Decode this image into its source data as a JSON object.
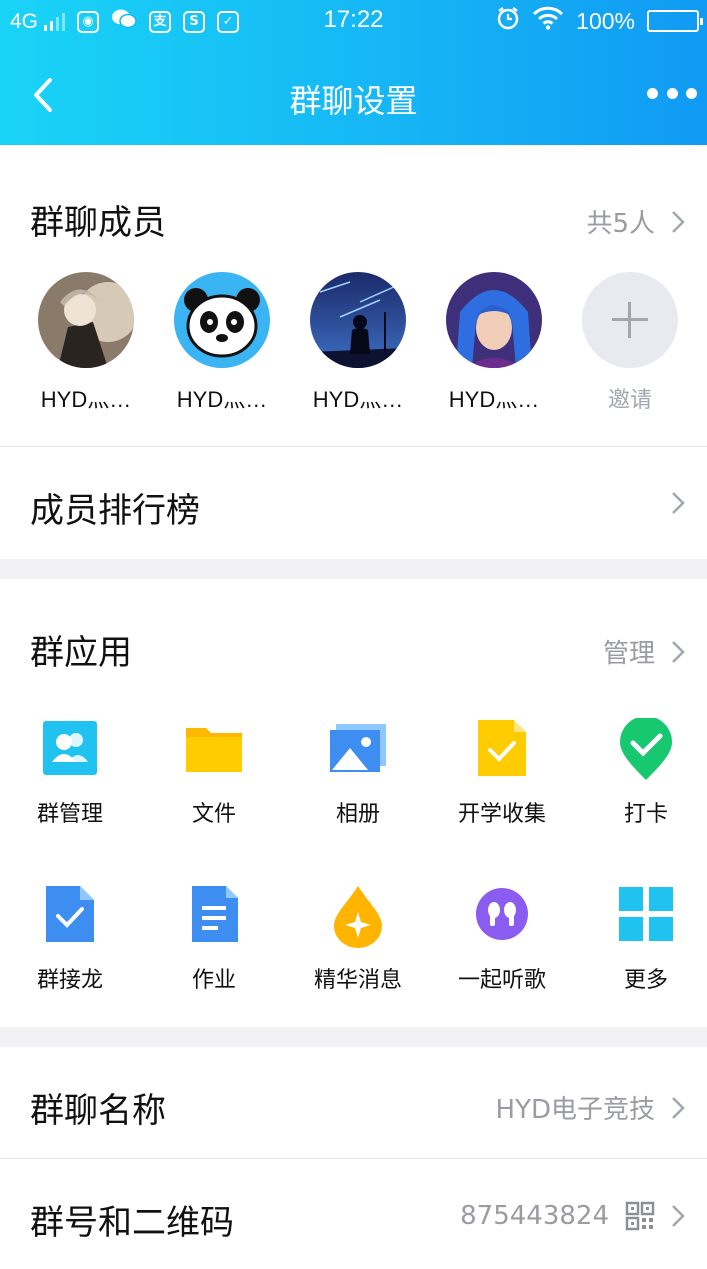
{
  "status_bar": {
    "network": "4G",
    "time": "17:22",
    "battery": "100%",
    "app_icons": [
      "globe-icon",
      "wechat-icon",
      "alipay-icon",
      "s-app-icon",
      "check-app-icon"
    ],
    "right_icons": [
      "alarm-icon",
      "wifi-icon",
      "battery-icon"
    ]
  },
  "nav": {
    "title": "群聊设置",
    "back_icon": "back-arrow-icon",
    "more_icon": "more-dots-icon"
  },
  "members_section": {
    "title": "群聊成员",
    "count": "共5人",
    "members": [
      {
        "name": "HYD灬…",
        "avatar": "anime-boy-avatar"
      },
      {
        "name": "HYD灬…",
        "avatar": "panda-avatar"
      },
      {
        "name": "HYD灬…",
        "avatar": "night-silhouette-avatar"
      },
      {
        "name": "HYD灬…",
        "avatar": "blue-hair-avatar"
      }
    ],
    "invite_label": "邀请"
  },
  "ranking": {
    "title": "成员排行榜"
  },
  "apps_section": {
    "title": "群应用",
    "manage_label": "管理",
    "apps": [
      {
        "label": "群管理",
        "icon": "group-manage-icon"
      },
      {
        "label": "文件",
        "icon": "folder-icon"
      },
      {
        "label": "相册",
        "icon": "album-icon"
      },
      {
        "label": "开学收集",
        "icon": "collect-doc-icon"
      },
      {
        "label": "打卡",
        "icon": "checkin-pin-icon"
      },
      {
        "label": "群接龙",
        "icon": "relay-doc-icon"
      },
      {
        "label": "作业",
        "icon": "homework-icon"
      },
      {
        "label": "精华消息",
        "icon": "essence-drop-icon"
      },
      {
        "label": "一起听歌",
        "icon": "earphones-icon"
      },
      {
        "label": "更多",
        "icon": "more-grid-icon"
      }
    ]
  },
  "group_name": {
    "title": "群聊名称",
    "value": "HYD电子竞技"
  },
  "group_number": {
    "title": "群号和二维码",
    "value": "875443824",
    "icon": "qr-code-icon"
  },
  "colors": {
    "header_gradient_start": "#19d4f6",
    "header_gradient_end": "#109af3",
    "secondary_text": "#9a9ba3",
    "section_gap": "#f2f2f4"
  }
}
